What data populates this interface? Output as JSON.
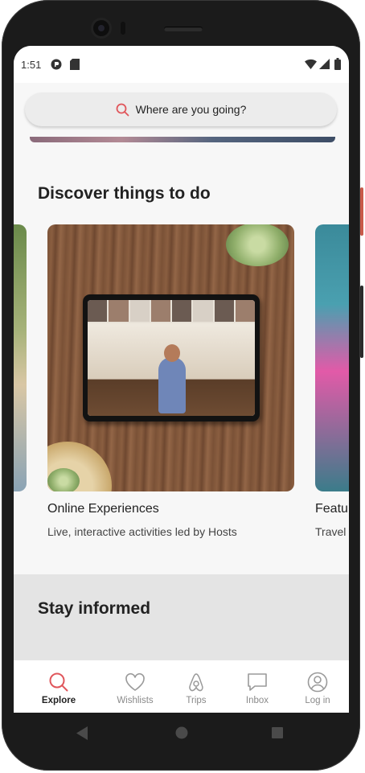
{
  "status_bar": {
    "time": "1:51",
    "left_icons": [
      "app-notification-icon",
      "sd-card-icon"
    ],
    "right_icons": [
      "wifi-icon",
      "cellular-signal-icon",
      "battery-icon"
    ]
  },
  "search": {
    "icon": "search-icon",
    "placeholder": "Where are you going?",
    "accent_color": "#e0565b"
  },
  "discover": {
    "title": "Discover things to do",
    "cards": [
      {
        "title": "Online Experiences",
        "subtitle": "Live, interactive activities led by Hosts"
      },
      {
        "title": "Featu",
        "subtitle": "Travel"
      }
    ]
  },
  "stay_informed": {
    "title": "Stay informed"
  },
  "bottom_nav": {
    "active_color": "#e0565b",
    "items": [
      {
        "label": "Explore",
        "icon": "search-icon",
        "active": true
      },
      {
        "label": "Wishlists",
        "icon": "heart-icon",
        "active": false
      },
      {
        "label": "Trips",
        "icon": "airbnb-logo-icon",
        "active": false
      },
      {
        "label": "Inbox",
        "icon": "chat-bubble-icon",
        "active": false
      },
      {
        "label": "Log in",
        "icon": "user-circle-icon",
        "active": false
      }
    ]
  },
  "system_nav": {
    "icons": [
      "back-icon",
      "home-icon",
      "recents-icon"
    ]
  }
}
